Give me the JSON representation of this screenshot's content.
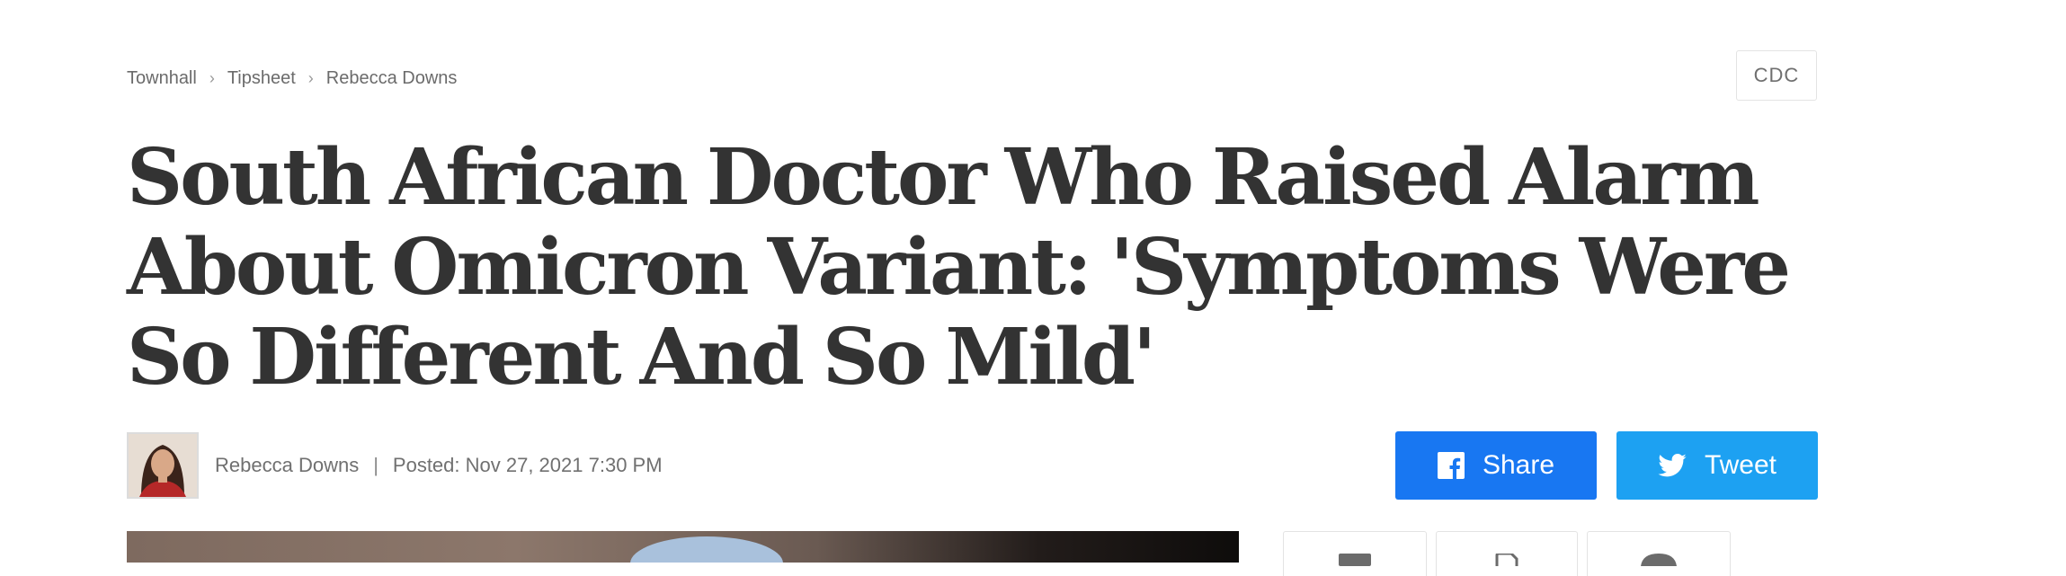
{
  "breadcrumb": {
    "items": [
      "Townhall",
      "Tipsheet",
      "Rebecca Downs"
    ],
    "separator": "›"
  },
  "tag": {
    "label": "CDC"
  },
  "article": {
    "title": "South African Doctor Who Raised Alarm About Omicron Variant: 'Symptoms Were So Different And So Mild'",
    "author": "Rebecca Downs",
    "divider": "|",
    "posted": "Posted: Nov 27, 2021 7:30 PM"
  },
  "share": {
    "facebook": {
      "label": "Share",
      "icon": "facebook-icon",
      "color": "#1877f2"
    },
    "twitter": {
      "label": "Tweet",
      "icon": "twitter-icon",
      "color": "#1da1f2"
    }
  },
  "tools": {
    "icons": [
      "archive-icon",
      "document-icon",
      "comment-icon"
    ]
  }
}
